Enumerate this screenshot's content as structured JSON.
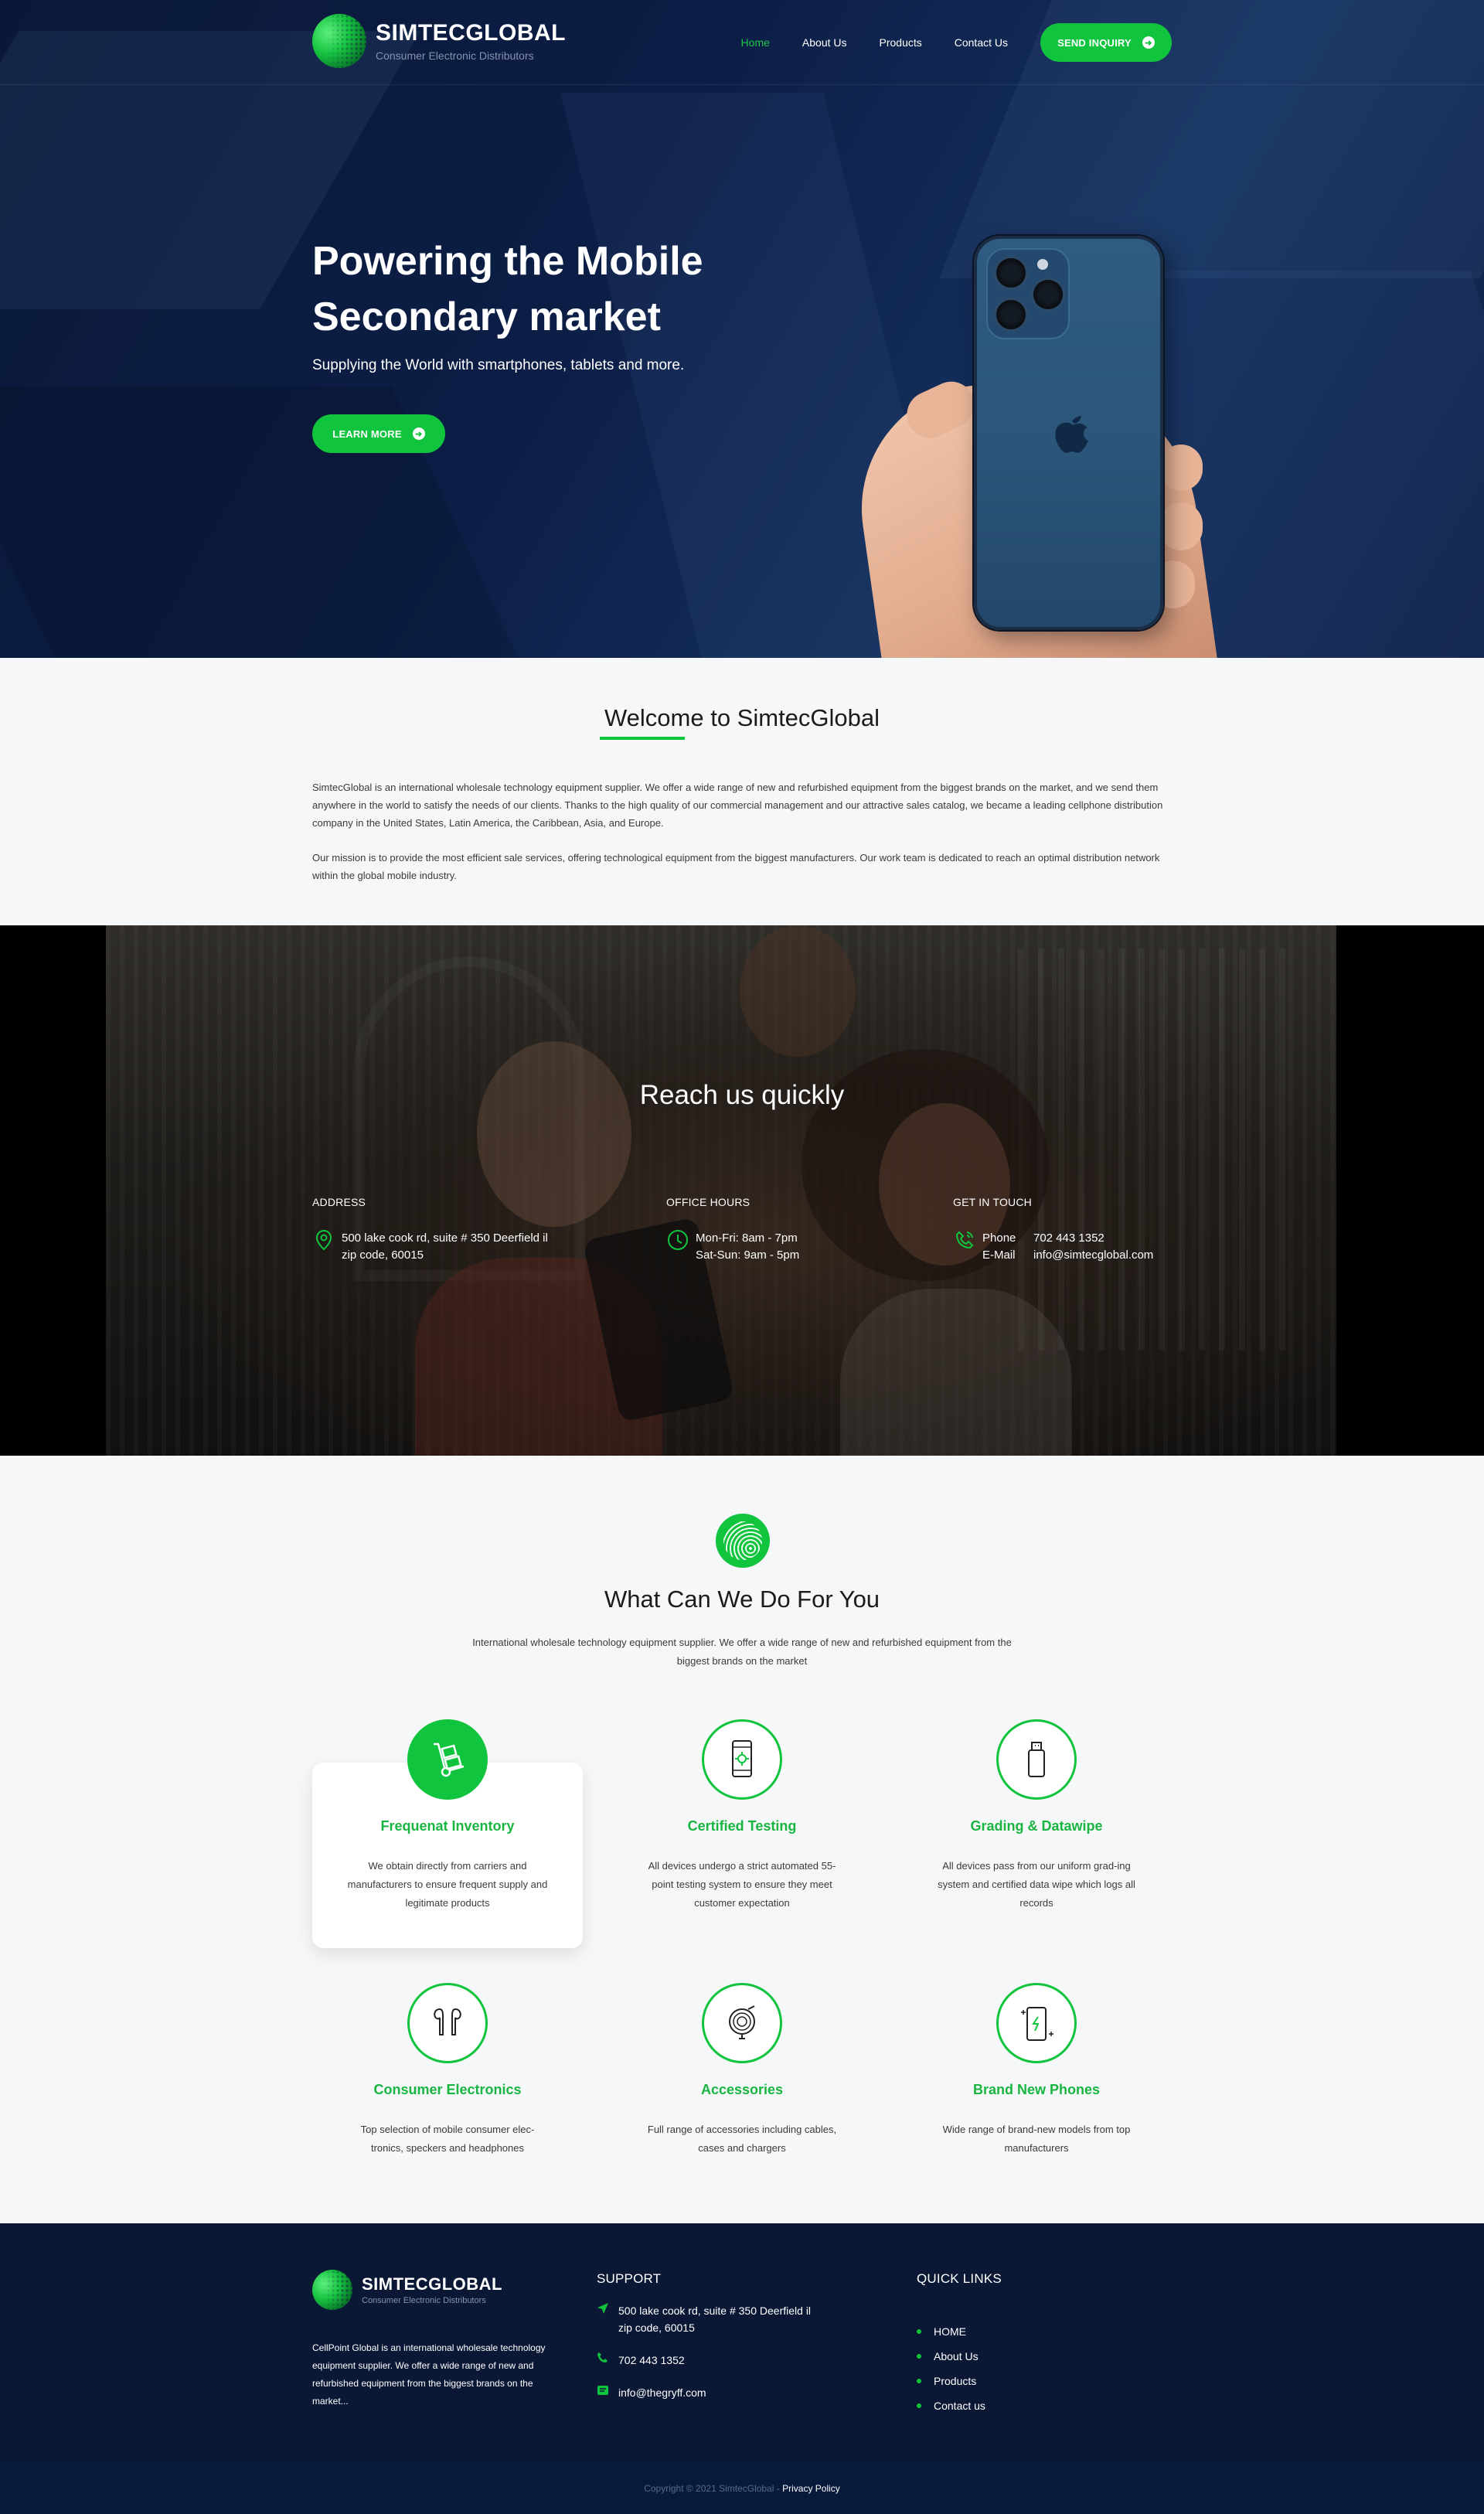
{
  "header": {
    "brand_name": "SIMTECGLOBAL",
    "brand_tagline": "Consumer Electronic Distributors",
    "nav": [
      "Home",
      "About Us",
      "Products",
      "Contact Us"
    ],
    "cta": "SEND INQUIRY"
  },
  "hero": {
    "title": "Powering the Mobile Secondary market",
    "subtitle": "Supplying the World with smartphones, tablets and more.",
    "button": "LEARN MORE"
  },
  "welcome": {
    "title": "Welcome to SimtecGlobal",
    "p1": "SimtecGlobal is an international wholesale technology equipment supplier. We offer a wide range of new and refurbished equipment from the biggest brands on the market, and we send them anywhere in the world to satisfy the needs of our clients. Thanks to the high quality of our commercial management and our attractive sales catalog, we became a leading cellphone distribution company in the United States, Latin America, the Caribbean, Asia, and Europe.",
    "p2": "Our mission is to provide the most efficient sale services, offering technological equipment from the biggest manufacturers. Our work team is dedicated to reach an optimal distribution network within the global mobile industry."
  },
  "reach": {
    "title": "Reach us quickly",
    "address_label": "ADDRESS",
    "address_line1": "500 lake cook rd, suite # 350 Deerfield il",
    "address_line2": "zip code, 60015",
    "hours_label": "OFFICE HOURS",
    "hours_line1": "Mon-Fri: 8am - 7pm",
    "hours_line2": "Sat-Sun: 9am - 5pm",
    "contact_label": "GET IN TOUCH",
    "phone_key": "Phone",
    "phone_value": "702 443 1352",
    "email_key": "E-Mail",
    "email_value": "info@simtecglobal.com"
  },
  "services": {
    "title": "What Can We Do For You",
    "intro": "International wholesale technology equipment supplier. We offer a wide range of new and refurbished equipment from the biggest brands on the market",
    "items": [
      {
        "title": "Frequenat Inventory",
        "desc": "We obtain directly from carriers and manufacturers to ensure frequent supply and legitimate products",
        "icon": "hand-truck-icon"
      },
      {
        "title": "Certified Testing",
        "desc": "All devices undergo a strict automated 55-point testing system to ensure they meet customer expectation",
        "icon": "phone-test-icon"
      },
      {
        "title": "Grading & Datawipe",
        "desc": "All devices pass from our uniform grad-ing system and certified data wipe which logs all records",
        "icon": "usb-drive-icon"
      },
      {
        "title": "Consumer Electronics",
        "desc": "Top selection of mobile consumer elec-tronics, speckers and headphones",
        "icon": "earbuds-icon"
      },
      {
        "title": "Accessories",
        "desc": "Full range of accessories including cables, cases and chargers",
        "icon": "cable-icon"
      },
      {
        "title": "Brand New Phones",
        "desc": "Wide range of brand-new models from top manufacturers",
        "icon": "new-phone-icon"
      }
    ]
  },
  "footer": {
    "about": "CellPoint Global is an international wholesale technology equipment supplier. We offer a wide range of new and refurbished equipment from the biggest brands on the market...",
    "support_title": "SUPPORT",
    "support_address_line1": "500 lake cook rd, suite # 350 Deerfield il",
    "support_address_line2": "zip code, 60015",
    "support_phone": "702 443 1352",
    "support_email": "info@thegryff.com",
    "links_title": "QUICK LINKS",
    "links": [
      "HOME",
      "About Us",
      "Products",
      "Contact us"
    ],
    "copyright": "Copyright © 2021 SimtecGlobal - ",
    "privacy": "Privacy Policy"
  },
  "colors": {
    "accent": "#11c43e",
    "navy": "#0b1835"
  }
}
